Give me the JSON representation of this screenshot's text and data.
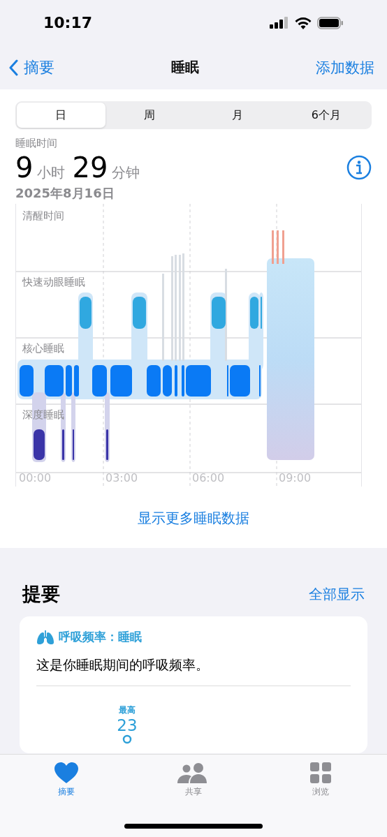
{
  "status_bar": {
    "time": "10:17"
  },
  "nav": {
    "back": "摘要",
    "title": "睡眠",
    "action": "添加数据"
  },
  "segments": [
    {
      "label": "日",
      "selected": true
    },
    {
      "label": "周",
      "selected": false
    },
    {
      "label": "月",
      "selected": false
    },
    {
      "label": "6个月",
      "selected": false
    }
  ],
  "summary": {
    "label": "睡眠时间",
    "hours": "9",
    "hours_unit": "小时",
    "minutes": "29",
    "minutes_unit": "分钟",
    "date": "2025年8月16日"
  },
  "sleep_chart": {
    "stages": [
      "清醒时间",
      "快速动眼睡眠",
      "核心睡眠",
      "深度睡眠"
    ],
    "times": [
      "00:00",
      "03:00",
      "06:00",
      "09:00"
    ]
  },
  "more_link": "显示更多睡眠数据",
  "highlights": {
    "title": "提要",
    "show_all": "全部显示",
    "card": {
      "title": "呼吸频率：睡眠",
      "text": "这是你睡眠期间的呼吸频率。",
      "max_label": "最高",
      "max_value": "23"
    }
  },
  "tab_bar": [
    {
      "label": "摘要",
      "kind": "heart",
      "selected": true
    },
    {
      "label": "共享",
      "kind": "people",
      "selected": false
    },
    {
      "label": "浏览",
      "kind": "grid",
      "selected": false
    }
  ]
}
